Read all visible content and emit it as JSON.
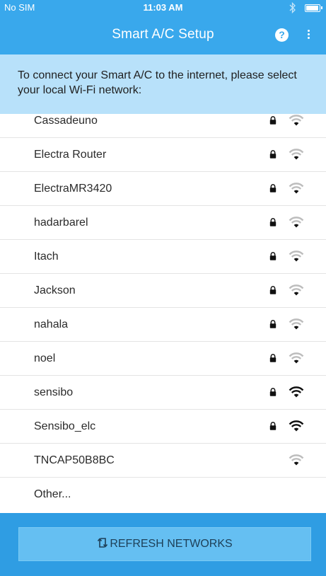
{
  "status_bar": {
    "carrier": "No SIM",
    "time": "11:03 AM"
  },
  "app_bar": {
    "title": "Smart A/C Setup",
    "help_label": "?"
  },
  "instruction": "To connect your Smart A/C to the internet, please select your local Wi-Fi network:",
  "networks": [
    {
      "name": "Cassadeuno",
      "locked": true,
      "strength": "weak"
    },
    {
      "name": "Electra Router",
      "locked": true,
      "strength": "weak"
    },
    {
      "name": "ElectraMR3420",
      "locked": true,
      "strength": "weak"
    },
    {
      "name": "hadarbarel",
      "locked": true,
      "strength": "weak"
    },
    {
      "name": "Itach",
      "locked": true,
      "strength": "weak"
    },
    {
      "name": "Jackson",
      "locked": true,
      "strength": "weak"
    },
    {
      "name": "nahala",
      "locked": true,
      "strength": "weak"
    },
    {
      "name": "noel",
      "locked": true,
      "strength": "weak"
    },
    {
      "name": "sensibo",
      "locked": true,
      "strength": "strong"
    },
    {
      "name": "Sensibo_elc",
      "locked": true,
      "strength": "strong"
    },
    {
      "name": "TNCAP50B8BC",
      "locked": false,
      "strength": "medium"
    },
    {
      "name": "Other...",
      "locked": false,
      "strength": "none"
    }
  ],
  "footer": {
    "refresh_label": "REFRESH NETWORKS"
  },
  "colors": {
    "primary": "#39a8ec",
    "banner": "#b8e1fa",
    "footer": "#2f9de3",
    "button": "#65bff2",
    "wifi_strong": "#111111",
    "wifi_weak": "#bdbdbd"
  }
}
